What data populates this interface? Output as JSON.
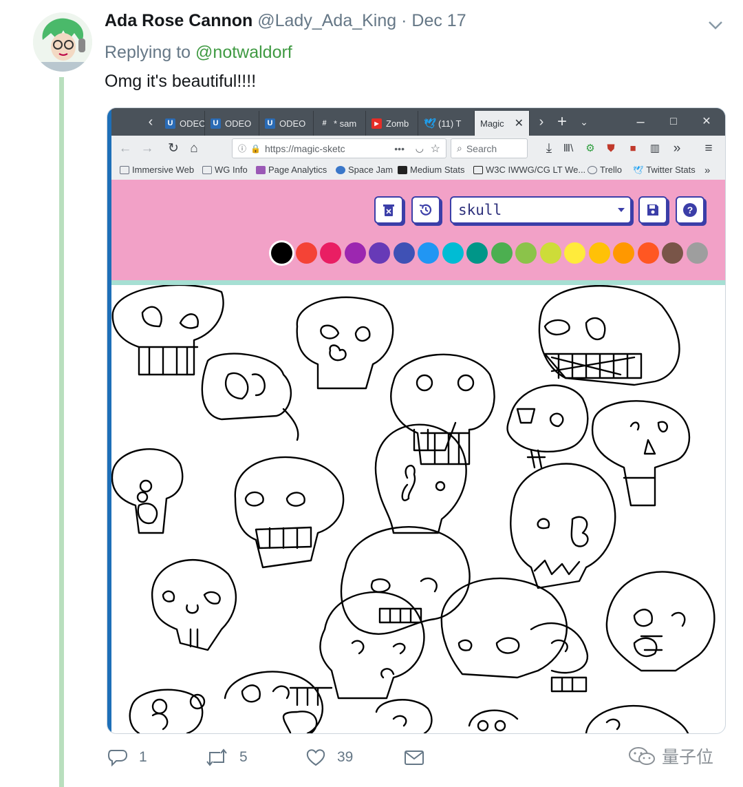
{
  "tweet": {
    "display_name": "Ada Rose Cannon",
    "handle": "@Lady_Ada_King",
    "separator": "·",
    "date": "Dec 17",
    "replying_prefix": "Replying to",
    "replying_to": "@notwaldorf",
    "text": "Omg it's beautiful!!!!"
  },
  "browser": {
    "tabs": [
      {
        "label": "ODEO",
        "icon": "odeo-icon",
        "color": "#2a6bb5"
      },
      {
        "label": "ODEO",
        "icon": "odeo-icon",
        "color": "#2a6bb5"
      },
      {
        "label": "ODEO",
        "icon": "odeo-icon",
        "color": "#2a6bb5"
      },
      {
        "label": "* sam",
        "icon": "slack-icon",
        "color": "#4a154b"
      },
      {
        "label": "Zomb",
        "icon": "youtube-icon",
        "color": "#e52d27"
      },
      {
        "label": "(11) T",
        "icon": "twitter-icon",
        "color": "#1da1f2"
      },
      {
        "label": "Magic",
        "icon": "",
        "color": "#ebedef"
      }
    ],
    "url": "https://magic-sketc",
    "search_placeholder": "Search",
    "bookmarks": [
      {
        "label": "Immersive Web",
        "icon": "folder-icon"
      },
      {
        "label": "WG Info",
        "icon": "folder-icon"
      },
      {
        "label": "Page Analytics",
        "icon": "analytics-icon"
      },
      {
        "label": "Space Jam",
        "icon": "globe-icon"
      },
      {
        "label": "Medium Stats",
        "icon": "medium-icon"
      },
      {
        "label": "W3C IWWG/CG LT We...",
        "icon": "notion-icon"
      },
      {
        "label": "Trello",
        "icon": "globe-icon"
      },
      {
        "label": "Twitter Stats",
        "icon": "twitter-icon"
      }
    ]
  },
  "app": {
    "category_value": "skull",
    "palette": [
      "#000000",
      "#f44336",
      "#e91e63",
      "#9c27b0",
      "#673ab7",
      "#3f51b5",
      "#2196f3",
      "#00bcd4",
      "#009688",
      "#4caf50",
      "#8bc34a",
      "#cddc39",
      "#ffeb3b",
      "#ffc107",
      "#ff9800",
      "#ff5722",
      "#795548",
      "#9e9e9e"
    ],
    "selected_color": "#000000",
    "toolbar_bg": "#f2a1c7",
    "accent": "#3b3ea8"
  },
  "actions": {
    "replies": "1",
    "retweets": "5",
    "likes": "39"
  },
  "watermark": "量子位"
}
